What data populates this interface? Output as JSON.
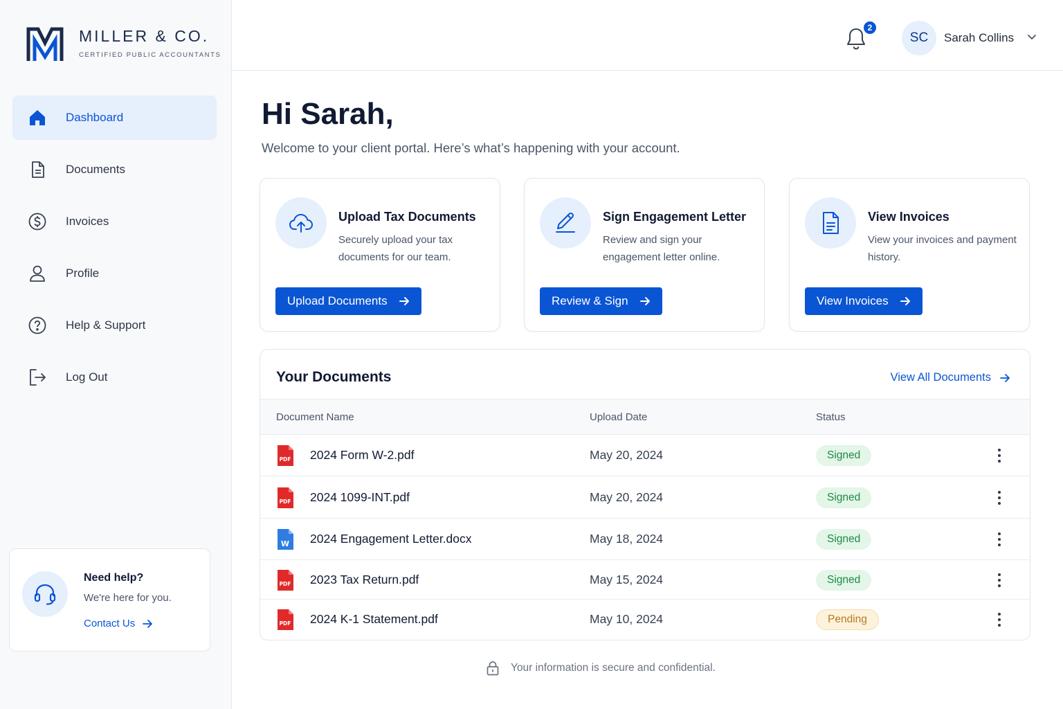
{
  "brand": {
    "name": "MILLER & CO.",
    "tagline": "CERTIFIED PUBLIC ACCOUNTANTS",
    "accent": "#0a55d4",
    "navy": "#1b2a4a"
  },
  "sidebar": {
    "items": [
      {
        "label": "Dashboard",
        "icon": "home-icon",
        "active": true
      },
      {
        "label": "Documents",
        "icon": "document-icon",
        "active": false
      },
      {
        "label": "Invoices",
        "icon": "dollar-circle-icon",
        "active": false
      },
      {
        "label": "Profile",
        "icon": "user-icon",
        "active": false
      },
      {
        "label": "Help & Support",
        "icon": "question-circle-icon",
        "active": false
      },
      {
        "label": "Log Out",
        "icon": "logout-icon",
        "active": false
      }
    ],
    "help": {
      "title": "Need help?",
      "subtitle": "We're here for you.",
      "link": "Contact Us"
    }
  },
  "header": {
    "notifications_count": "2",
    "user_initials": "SC",
    "user_name": "Sarah Collins"
  },
  "main": {
    "greeting": "Hi Sarah,",
    "welcome": "Welcome to your client portal. Here’s what’s happening with your account.",
    "cards": [
      {
        "title": "Upload Tax Documents",
        "description": "Securely upload your tax documents for our team.",
        "button": "Upload Documents",
        "icon": "cloud-upload-icon"
      },
      {
        "title": "Sign Engagement Letter",
        "description": "Review and sign your engagement letter online.",
        "button": "Review & Sign",
        "icon": "pen-sign-icon"
      },
      {
        "title": "View Invoices",
        "description": "View your invoices and payment history.",
        "button": "View Invoices",
        "icon": "invoice-icon"
      }
    ],
    "documents": {
      "title": "Your Documents",
      "view_all": "View All Documents",
      "columns": [
        "Document Name",
        "Upload Date",
        "Status"
      ],
      "rows": [
        {
          "name": "2024 Form W-2.pdf",
          "date": "May 20, 2024",
          "status": "Signed",
          "type": "pdf"
        },
        {
          "name": "2024 1099-INT.pdf",
          "date": "May 20, 2024",
          "status": "Signed",
          "type": "pdf"
        },
        {
          "name": "2024 Engagement Letter.docx",
          "date": "May 18, 2024",
          "status": "Signed",
          "type": "docx"
        },
        {
          "name": "2023 Tax Return.pdf",
          "date": "May 15, 2024",
          "status": "Signed",
          "type": "pdf"
        },
        {
          "name": "2024 K-1 Statement.pdf",
          "date": "May 10, 2024",
          "status": "Pending",
          "type": "pdf"
        }
      ]
    },
    "footer_note": "Your information is secure and confidential."
  }
}
